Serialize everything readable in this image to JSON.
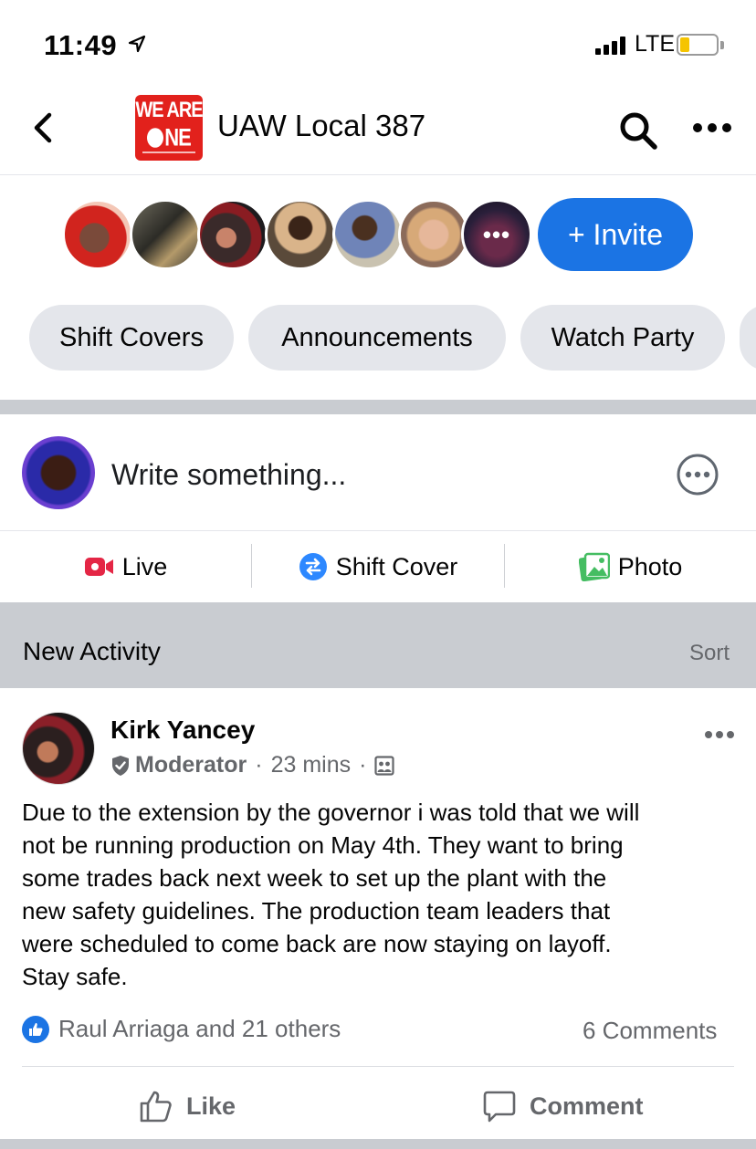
{
  "status_bar": {
    "time": "11:49",
    "network": "LTE",
    "battery_level": 0.25
  },
  "header": {
    "logo_line1": "WE ARE",
    "logo_line2": "NE",
    "group_name": "UAW Local 387"
  },
  "members": {
    "avatars": [
      "member-1",
      "member-2",
      "member-3",
      "member-4",
      "member-5",
      "member-6",
      "member-7"
    ],
    "more_label": "•••",
    "invite_label": "+ Invite"
  },
  "chips": [
    "Shift Covers",
    "Announcements",
    "Watch Party"
  ],
  "composer": {
    "placeholder": "Write something..."
  },
  "actions": {
    "live": "Live",
    "shift_cover": "Shift Cover",
    "photo": "Photo"
  },
  "activity": {
    "title": "New Activity",
    "sort": "Sort"
  },
  "post": {
    "author": "Kirk Yancey",
    "role": "Moderator",
    "time": "23 mins",
    "separator": "·",
    "body": [
      "Due to the extension by the governor i was told that we will",
      "not be running production on May 4th.  They want to bring",
      "some trades back next week to set up the plant with the",
      "new safety guidelines. The production team leaders that",
      "were scheduled to come back are now staying on layoff.",
      "Stay safe."
    ],
    "reactions": "Raul Arriaga and 21 others",
    "comments": "6 Comments",
    "like_label": "Like",
    "comment_label": "Comment"
  },
  "colors": {
    "accent": "#1b74e4",
    "logo_red": "#e2211c",
    "live_red": "#e42645",
    "photo_green": "#45bd62",
    "chip_bg": "#e4e6eb"
  }
}
